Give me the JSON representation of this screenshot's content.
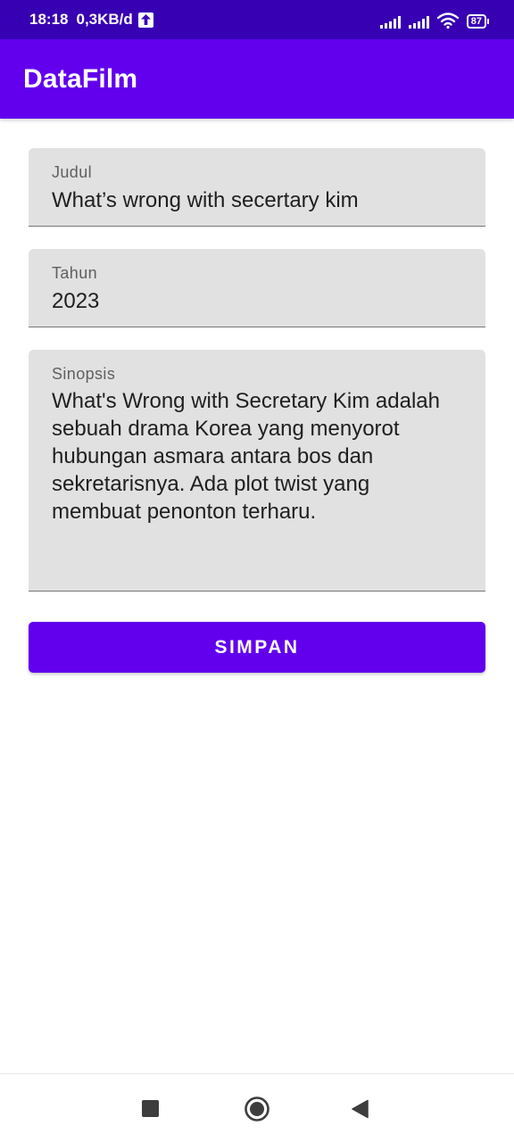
{
  "status_bar": {
    "time": "18:18",
    "network_speed": "0,3KB/d",
    "battery_level": "87",
    "icons": [
      "upload-icon",
      "signal-icon",
      "signal-icon",
      "wifi-icon",
      "battery-icon"
    ]
  },
  "app_bar": {
    "title": "DataFilm",
    "color": "#6200ee"
  },
  "form": {
    "judul": {
      "label": "Judul",
      "value": "What’s wrong with secertary kim"
    },
    "tahun": {
      "label": "Tahun",
      "value": "2023"
    },
    "sinopsis": {
      "label": "Sinopsis",
      "value": "What's Wrong with Secretary Kim adalah sebuah drama Korea yang menyorot hubungan asmara antara bos dan sekretarisnya. Ada plot twist yang membuat penonton terharu."
    },
    "save_label": "SIMPAN"
  },
  "nav_bar": {
    "icons": [
      "recents-icon",
      "home-icon",
      "back-icon"
    ]
  },
  "colors": {
    "status_bar": "#3700b3",
    "primary": "#6200ee",
    "field_background": "#e1e1e1"
  }
}
